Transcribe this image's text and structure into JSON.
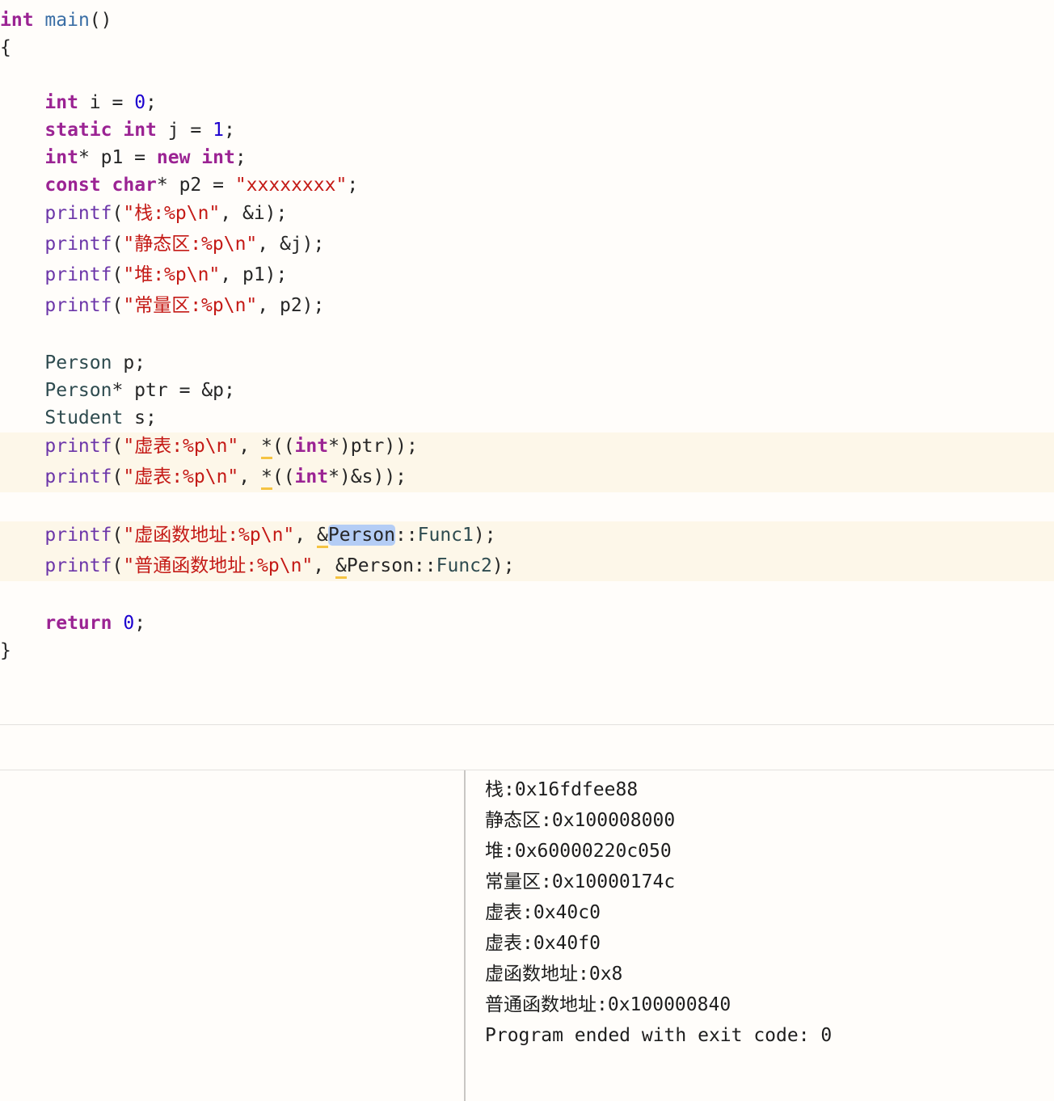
{
  "editor": {
    "lines": [
      [
        {
          "t": "int",
          "c": "kw"
        },
        {
          "t": " "
        },
        {
          "t": "main",
          "c": "fn"
        },
        {
          "t": "()"
        }
      ],
      [
        {
          "t": "{"
        }
      ],
      [],
      [
        {
          "t": "    "
        },
        {
          "t": "int",
          "c": "kw"
        },
        {
          "t": " i = "
        },
        {
          "t": "0",
          "c": "num"
        },
        {
          "t": ";"
        }
      ],
      [
        {
          "t": "    "
        },
        {
          "t": "static",
          "c": "kw"
        },
        {
          "t": " "
        },
        {
          "t": "int",
          "c": "kw"
        },
        {
          "t": " j = "
        },
        {
          "t": "1",
          "c": "num"
        },
        {
          "t": ";"
        }
      ],
      [
        {
          "t": "    "
        },
        {
          "t": "int",
          "c": "kw"
        },
        {
          "t": "* p1 = "
        },
        {
          "t": "new",
          "c": "kw"
        },
        {
          "t": " "
        },
        {
          "t": "int",
          "c": "kw"
        },
        {
          "t": ";"
        }
      ],
      [
        {
          "t": "    "
        },
        {
          "t": "const",
          "c": "kw"
        },
        {
          "t": " "
        },
        {
          "t": "char",
          "c": "kw"
        },
        {
          "t": "* p2 = "
        },
        {
          "t": "\"xxxxxxxx\"",
          "c": "str"
        },
        {
          "t": ";"
        }
      ],
      [
        {
          "t": "    "
        },
        {
          "t": "printf",
          "c": "lib"
        },
        {
          "t": "("
        },
        {
          "t": "\"栈:%p\\n\"",
          "c": "str"
        },
        {
          "t": ", &i);"
        }
      ],
      [
        {
          "t": "    "
        },
        {
          "t": "printf",
          "c": "lib"
        },
        {
          "t": "("
        },
        {
          "t": "\"静态区:%p\\n\"",
          "c": "str"
        },
        {
          "t": ", &j);"
        }
      ],
      [
        {
          "t": "    "
        },
        {
          "t": "printf",
          "c": "lib"
        },
        {
          "t": "("
        },
        {
          "t": "\"堆:%p\\n\"",
          "c": "str"
        },
        {
          "t": ", p1);"
        }
      ],
      [
        {
          "t": "    "
        },
        {
          "t": "printf",
          "c": "lib"
        },
        {
          "t": "("
        },
        {
          "t": "\"常量区:%p\\n\"",
          "c": "str"
        },
        {
          "t": ", p2);"
        }
      ],
      [],
      [
        {
          "t": "    "
        },
        {
          "t": "Person",
          "c": "type"
        },
        {
          "t": " p;"
        }
      ],
      [
        {
          "t": "    "
        },
        {
          "t": "Person",
          "c": "type"
        },
        {
          "t": "* ptr = &p;"
        }
      ],
      [
        {
          "t": "    "
        },
        {
          "t": "Student",
          "c": "type"
        },
        {
          "t": " s;"
        }
      ],
      [
        {
          "t": "    "
        },
        {
          "t": "printf",
          "c": "lib"
        },
        {
          "t": "("
        },
        {
          "t": "\"虚表:%p\\n\"",
          "c": "str"
        },
        {
          "t": ", "
        },
        {
          "t": "*",
          "c": "warn-mark"
        },
        {
          "t": "(("
        },
        {
          "t": "int",
          "c": "kw"
        },
        {
          "t": "*)ptr));"
        }
      ],
      [
        {
          "t": "    "
        },
        {
          "t": "printf",
          "c": "lib"
        },
        {
          "t": "("
        },
        {
          "t": "\"虚表:%p\\n\"",
          "c": "str"
        },
        {
          "t": ", "
        },
        {
          "t": "*",
          "c": "warn-mark"
        },
        {
          "t": "(("
        },
        {
          "t": "int",
          "c": "kw"
        },
        {
          "t": "*)&s));"
        }
      ],
      [],
      [
        {
          "t": "    "
        },
        {
          "t": "printf",
          "c": "lib"
        },
        {
          "t": "("
        },
        {
          "t": "\"虚函数地址:%p\\n\"",
          "c": "str"
        },
        {
          "t": ", "
        },
        {
          "t": "&",
          "c": "warn-mark"
        },
        {
          "t": "Person",
          "c": "sel"
        },
        {
          "t": "::"
        },
        {
          "t": "Func1",
          "c": "member"
        },
        {
          "t": ");"
        }
      ],
      [
        {
          "t": "    "
        },
        {
          "t": "printf",
          "c": "lib"
        },
        {
          "t": "("
        },
        {
          "t": "\"普通函数地址:%p\\n\"",
          "c": "str"
        },
        {
          "t": ", "
        },
        {
          "t": "&",
          "c": "warn-mark"
        },
        {
          "t": "Person::"
        },
        {
          "t": "Func2",
          "c": "member"
        },
        {
          "t": ");"
        }
      ],
      [],
      [
        {
          "t": "    "
        },
        {
          "t": "return",
          "c": "kw"
        },
        {
          "t": " "
        },
        {
          "t": "0",
          "c": "num"
        },
        {
          "t": ";"
        }
      ],
      [
        {
          "t": "}"
        }
      ]
    ]
  },
  "console": {
    "lines": [
      "栈:0x16fdfee88",
      "静态区:0x100008000",
      "堆:0x60000220c050",
      "常量区:0x10000174c",
      "虚表:0x40c0",
      "虚表:0x40f0",
      "虚函数地址:0x8",
      "普通函数地址:0x100000840",
      "Program ended with exit code: 0"
    ]
  }
}
